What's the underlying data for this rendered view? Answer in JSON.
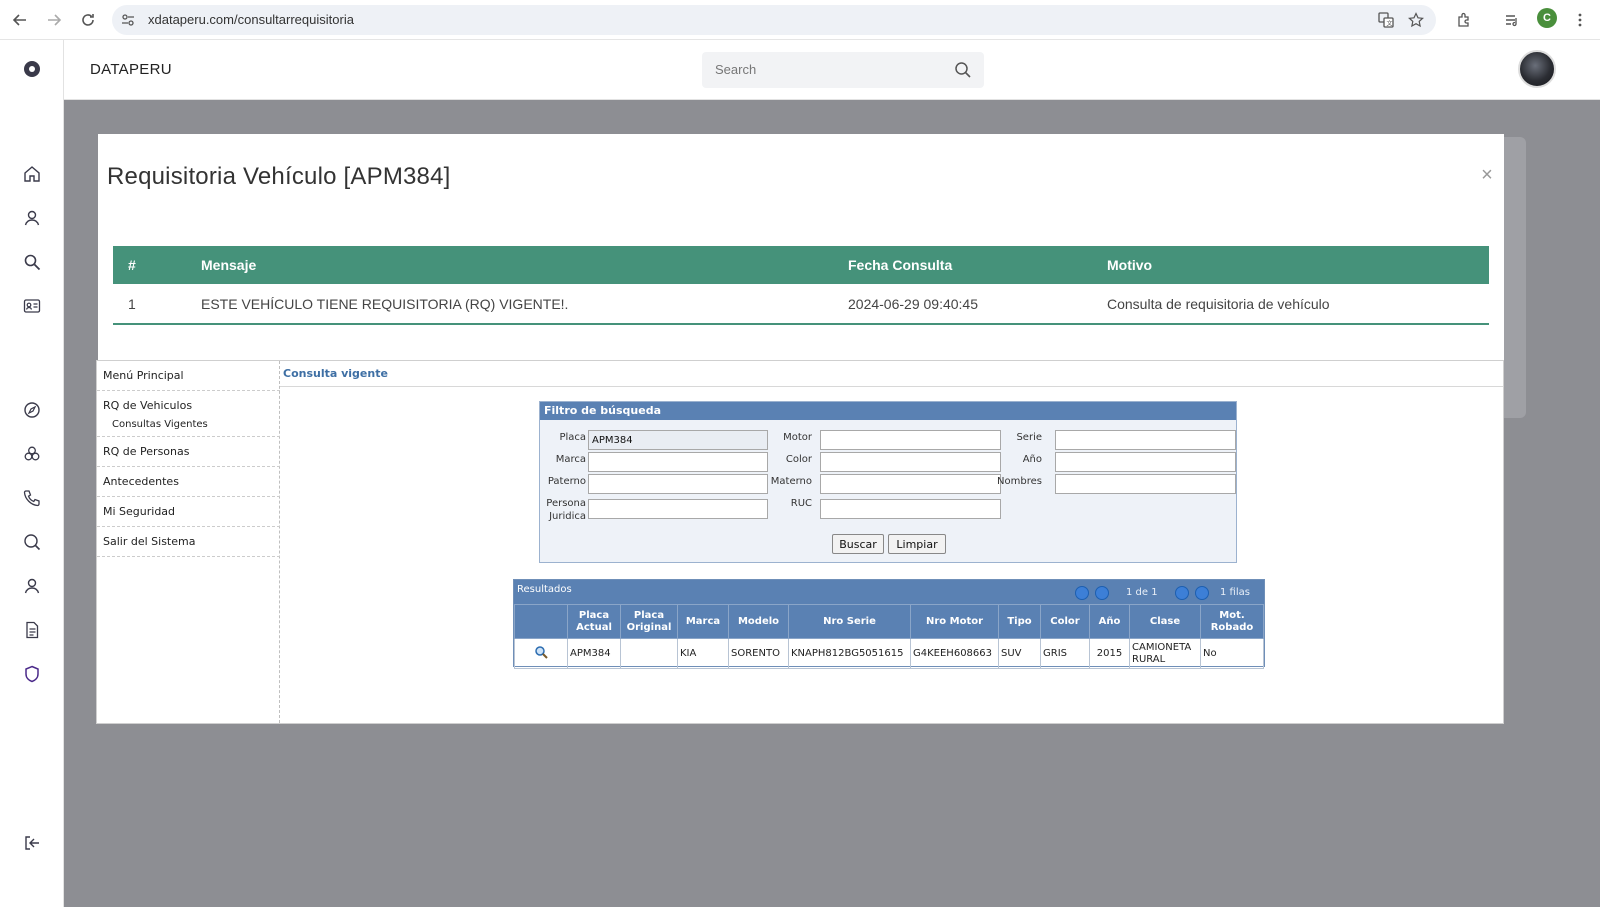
{
  "browser": {
    "url": "xdataperu.com/consultarrequisitoria",
    "profile_initial": "C"
  },
  "app": {
    "brand": "DATAPERU",
    "search_placeholder": "Search"
  },
  "modal": {
    "title": "Requisitoria Vehículo [APM384]",
    "close_label": "×",
    "table": {
      "headers": [
        "#",
        "Mensaje",
        "Fecha Consulta",
        "Motivo"
      ],
      "rows": [
        [
          "1",
          "ESTE VEHÍCULO TIENE REQUISITORIA (RQ) VIGENTE!.",
          "2024-06-29 09:40:45",
          "Consulta de requisitoria de vehículo"
        ]
      ]
    }
  },
  "legacy": {
    "menu": {
      "items": [
        "Menú Principal",
        "RQ de Vehiculos",
        "RQ de Personas",
        "Antecedentes",
        "Mi Seguridad",
        "Salir del Sistema"
      ],
      "sub_item": "Consultas Vigentes"
    },
    "content_title": "Consulta vigente",
    "filter": {
      "title": "Filtro de búsqueda",
      "labels": {
        "placa": "Placa",
        "motor": "Motor",
        "serie": "Serie",
        "marca": "Marca",
        "color": "Color",
        "anio": "Año",
        "paterno": "Paterno",
        "materno": "Materno",
        "nombres": "Nombres",
        "persona": "Persona",
        "juridica": "Juridica",
        "ruc": "RUC"
      },
      "values": {
        "placa": "APM384"
      },
      "buttons": {
        "buscar": "Buscar",
        "limpiar": "Limpiar"
      }
    },
    "results": {
      "title": "Resultados",
      "page_info": "1 de 1",
      "rows_info": "1 filas",
      "headers": [
        [
          "",
          ""
        ],
        [
          "Placa",
          "Actual"
        ],
        [
          "Placa",
          "Original"
        ],
        [
          "Marca",
          ""
        ],
        [
          "Modelo",
          ""
        ],
        [
          "Nro Serie",
          ""
        ],
        [
          "Nro Motor",
          ""
        ],
        [
          "Tipo",
          ""
        ],
        [
          "Color",
          ""
        ],
        [
          "Año",
          ""
        ],
        [
          "Clase",
          ""
        ],
        [
          "Mot.",
          "Robado"
        ]
      ],
      "row": {
        "placa_actual": "APM384",
        "placa_original": "",
        "marca": "KIA",
        "modelo": "SORENTO",
        "nro_serie": "KNAPH812BG5051615",
        "nro_motor": "G4KEEH608663",
        "tipo": "SUV",
        "color": "GRIS",
        "anio": "2015",
        "clase_1": "CAMIONETA",
        "clase_2": "RURAL",
        "mot_robado": "No"
      }
    }
  },
  "icons": {
    "rail": [
      "app-logo-icon",
      "home-icon",
      "user-icon",
      "search-icon",
      "id-card-icon",
      "compass-icon",
      "biohazard-icon",
      "phone-icon",
      "search-icon",
      "user-icon",
      "document-icon",
      "shield-icon",
      "logout-icon"
    ]
  },
  "colors": {
    "accent_green": "#45927a",
    "legacy_blue": "#5a81b3",
    "backdrop": "#8d8e93"
  }
}
